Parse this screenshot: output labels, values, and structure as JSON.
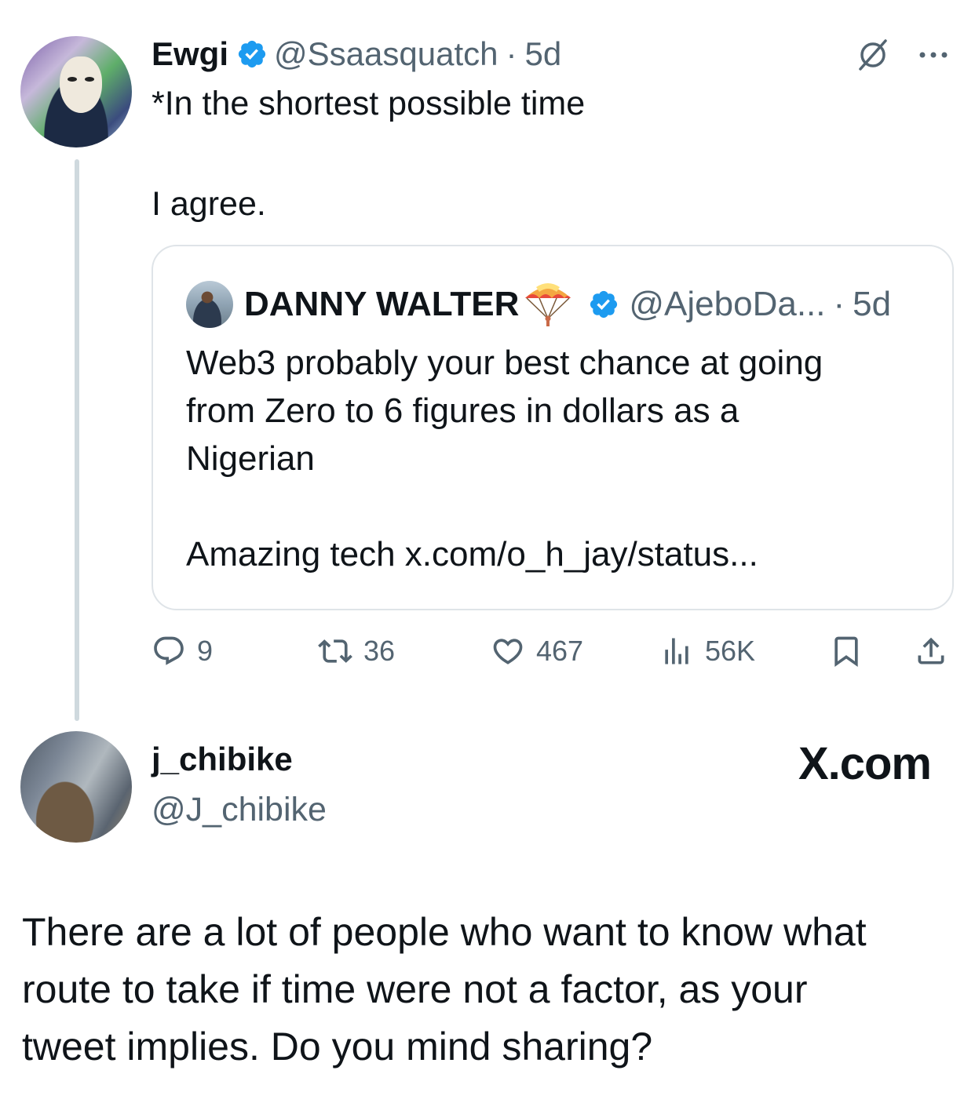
{
  "tweet": {
    "author_name": "Ewgi",
    "author_handle": "@Ssaasquatch",
    "separator": "·",
    "time": "5d",
    "text_line1": "*In the shortest possible time",
    "text_line2": "I agree.",
    "verified_color": "#1d9bf0",
    "icons": [
      "grok-icon",
      "more-icon",
      "verified-icon"
    ]
  },
  "quote": {
    "author_name": "DANNY WALTER",
    "author_handle": "@AjeboDa...",
    "separator": "·",
    "time": "5d",
    "lines": [
      "Web3 probably your best chance at going",
      "from Zero to 6 figures in dollars as a",
      "Nigerian"
    ],
    "link_text": "Amazing tech x.com/o_h_jay/status..."
  },
  "actions": {
    "replies": "9",
    "reposts": "36",
    "likes": "467",
    "views": "56K"
  },
  "reply": {
    "author_name": "j_chibike",
    "author_handle": "@J_chibike",
    "brand": "X.com",
    "lines": [
      "There are a lot of people who want to know what",
      "route to take if time were not a factor, as your",
      "tweet implies. Do you mind sharing?"
    ]
  }
}
